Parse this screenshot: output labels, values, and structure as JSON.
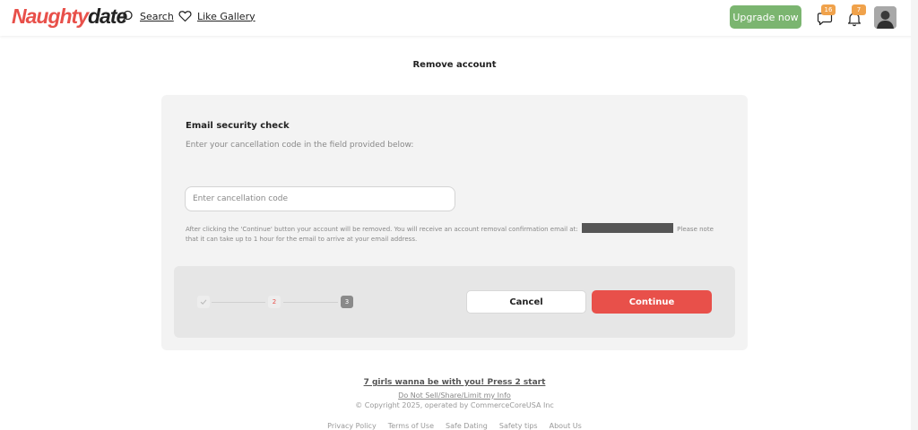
{
  "header": {
    "logo_part1": "Naughty",
    "logo_part2": "date",
    "search_label": "Search",
    "like_gallery_label": "Like Gallery",
    "upgrade_label": "Upgrade now",
    "messages_count": "16",
    "notifications_count": "7",
    "badge_color": "#f0a24b",
    "upgrade_color": "#7bb570"
  },
  "page": {
    "title": "Remove account"
  },
  "card": {
    "heading": "Email security check",
    "subheading": "Enter your cancellation code in the field provided below:",
    "input_placeholder": "Enter cancellation code",
    "input_value": "",
    "notice_part1": "After clicking the 'Continue' button your account will be removed. You will receive an account removal confirmation email at:",
    "notice_part2": "Please note that it can take up to 1 hour for the email to arrive at your email address."
  },
  "steps": {
    "step1_icon": "check-icon",
    "step2_label": "2",
    "step3_label": "3",
    "current_step": 2
  },
  "actions": {
    "cancel_label": "Cancel",
    "continue_label": "Continue",
    "accent_color": "#e8504a"
  },
  "footer": {
    "promo": "7 girls wanna be with you! Press 2 start",
    "do_not_sell": "Do Not Sell/Share/Limit my Info",
    "copyright": "© Copyright 2025, operated by CommerceCoreUSA Inc",
    "links": [
      "Privacy Policy",
      "Terms of Use",
      "Safe Dating",
      "Safety tips",
      "About Us"
    ]
  }
}
